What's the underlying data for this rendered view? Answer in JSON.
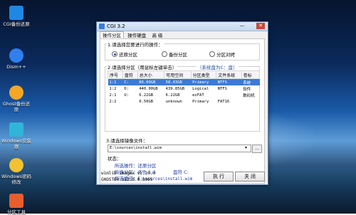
{
  "desktop": {
    "icons": [
      {
        "label": "CGI备份还原",
        "icon": "cgi-icon",
        "color": "#1e88e5"
      },
      {
        "label": "Dism++",
        "icon": "gear-icon",
        "color": "#2f80ed"
      },
      {
        "label": "Ghost备份还原",
        "icon": "ghost-icon",
        "color": "#f5a623"
      },
      {
        "label": "Windows安装器",
        "icon": "installer-icon",
        "color": "#2fb5d8"
      },
      {
        "label": "Windows密码修改",
        "icon": "key-icon",
        "color": "#f2c230"
      },
      {
        "label": "分区工具",
        "icon": "partition-icon",
        "color": "#e85d2a"
      }
    ]
  },
  "window": {
    "title": "CGI 3.2",
    "minimize": "—",
    "close": "✕",
    "tabs": [
      "操作分区",
      "操作硬盘",
      "高 级"
    ],
    "step1": {
      "label": "1.请选择您要进行的操作：",
      "options": [
        "还原分区",
        "备份分区",
        "分区对拷"
      ],
      "selected": 0
    },
    "step2": {
      "label": "2.请选择分区（用鼠标左键单击）",
      "hint": "（系统盘为C：盘）",
      "columns": [
        "序号",
        "盘符",
        "总大小",
        "可用空间",
        "分区类型",
        "文件系统",
        "卷标"
      ],
      "rows": [
        [
          "1:1",
          "C:",
          "80.00GB",
          "58.03GB",
          "Primary",
          "NTFS",
          "系统"
        ],
        [
          "1:2",
          "D:",
          "440.00GB",
          "439.85GB",
          "Logical",
          "NTFS",
          "软件"
        ],
        [
          "2:1",
          "U:",
          "6.22GB",
          "6.22GB",
          "exFAT",
          "",
          "数码机"
        ],
        [
          "2:2",
          "",
          "0.50GB",
          "unknown",
          "Primary",
          "FAT16",
          ""
        ]
      ],
      "selected_row": 0
    },
    "step3": {
      "label": "3.请选择镜像文件：",
      "path": "E:\\sources\\install.wim",
      "browse": "..."
    },
    "status": {
      "label": "状态：",
      "lines": [
        {
          "key": "所选操作：",
          "value": "还原分区"
        },
        {
          "key": "所选分区：",
          "value": "序号 1:1",
          "extra": "盘符 C:"
        },
        {
          "key": "所选路径：",
          "value": "E:\\sources\\install.wim"
        }
      ]
    },
    "versions": [
      "wimlib-imagex v1.10.0",
      "GHOST64 v12.0.0.8065"
    ],
    "buttons": {
      "execute": "执 行",
      "close": "关 闭"
    }
  }
}
